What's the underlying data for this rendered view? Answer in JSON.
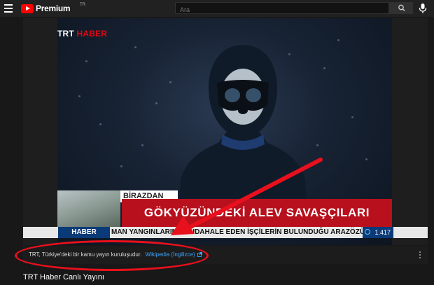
{
  "header": {
    "logo_text": "Premium",
    "logo_region": "TR",
    "search_placeholder": "Ara"
  },
  "video": {
    "channel_logo": {
      "part1": "TRT",
      "part2": "HABER"
    },
    "lower_third_tag": "BİRAZDAN",
    "lower_third_title": "GÖKYÜZÜNDEKİ ALEV SAVAŞÇILARI",
    "ticker_label": "HABER",
    "ticker_text": "MAN YANGINLARINA MÜDAHALE EDEN İŞÇİLERİN BULUNDUĞU ARAZÖZÜN D",
    "viewer_count": "1.417"
  },
  "info_panel": {
    "text": "TRT, Türkiye'deki bir kamu yayın kuruluşudur.",
    "link": "Wikipedia (İngilizce)"
  },
  "page_title": "TRT Haber Canlı Yayını",
  "colors": {
    "accent_red": "#e30613",
    "annotation_red": "#e8101c",
    "link_blue": "#3ea6ff",
    "ticker_blue": "#0b3a78"
  }
}
